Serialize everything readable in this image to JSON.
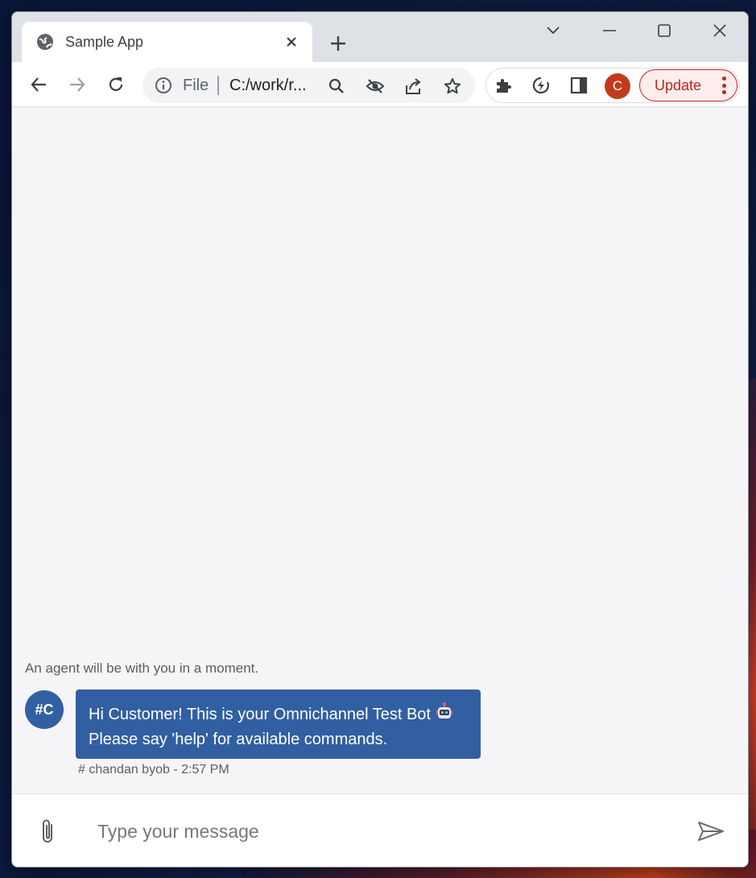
{
  "browser": {
    "tab_title": "Sample App",
    "omnibox": {
      "scheme": "File",
      "url": "C:/work/r..."
    },
    "profile_initial": "C",
    "update_label": "Update"
  },
  "chat": {
    "system_notice": "An agent will be with you in a moment.",
    "messages": [
      {
        "avatar_initials": "#C",
        "line1": "Hi Customer! This is your Omnichannel Test Bot",
        "line2": "Please say 'help' for available commands.",
        "meta": "# chandan byob - 2:57 PM"
      }
    ],
    "composer": {
      "placeholder": "Type your message"
    }
  },
  "colors": {
    "bot_bubble": "#315fa2",
    "update_accent": "#c5221f",
    "profile_avatar": "#c4391d"
  }
}
